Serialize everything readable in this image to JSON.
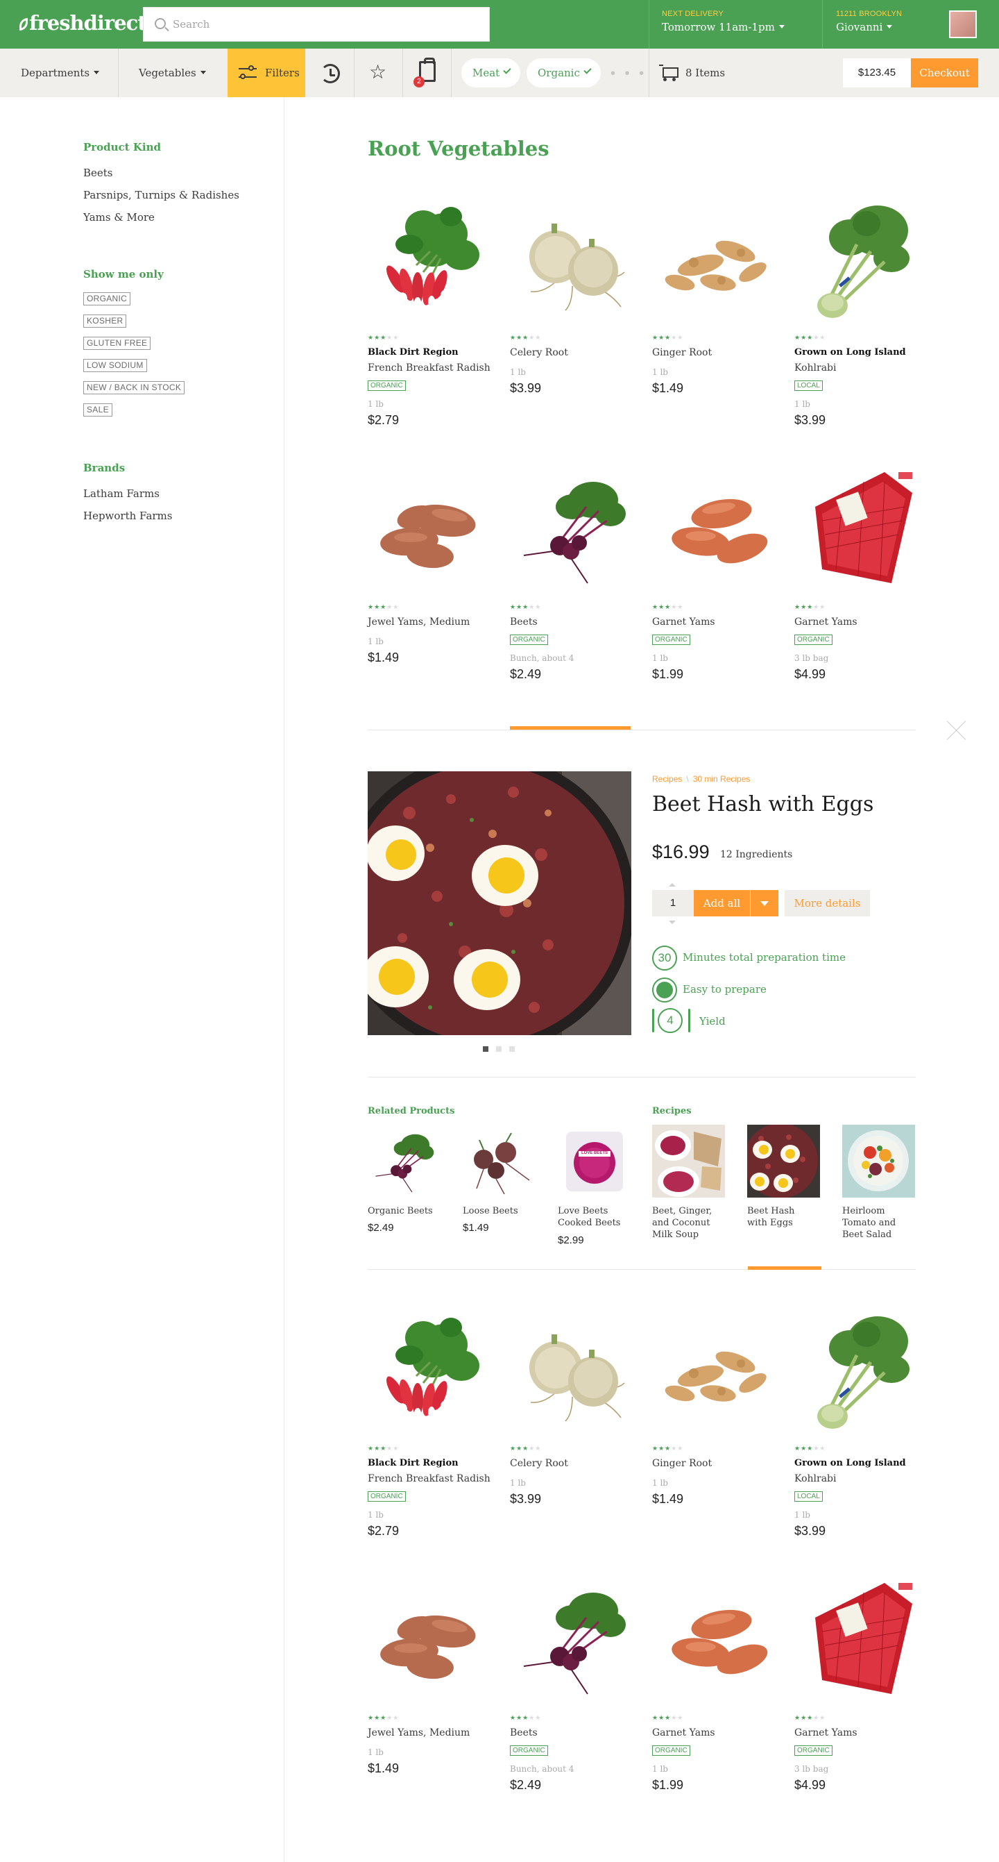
{
  "header": {
    "logo": "freshdirect",
    "search_placeholder": "Search",
    "delivery_label": "NEXT DELIVERY",
    "delivery_value": "Tomorrow 11am-1pm",
    "location_label": "11211 BROOKLYN",
    "user_name": "Giovanni"
  },
  "navbar": {
    "departments": "Departments",
    "vegetables": "Vegetables",
    "filters": "Filters",
    "bag_count": "2",
    "chips": [
      "Meat",
      "Organic"
    ],
    "dots": "• • •",
    "cart_items": "8 Items",
    "total": "$123.45",
    "checkout": "Checkout"
  },
  "sidebar": {
    "product_kind_title": "Product Kind",
    "product_kinds": [
      "Beets",
      "Parsnips, Turnips & Radishes",
      "Yams & More"
    ],
    "show_only_title": "Show me only",
    "show_only": [
      "ORGANIC",
      "KOSHER",
      "GLUTEN FREE",
      "LOW SODIUM",
      "NEW / BACK IN STOCK",
      "SALE"
    ],
    "brands_title": "Brands",
    "brands": [
      "Latham Farms",
      "Hepworth Farms"
    ]
  },
  "main": {
    "title": "Root Vegetables",
    "stars_text": "★★★★★",
    "products": [
      {
        "brand": "Black Dirt Region",
        "name": "French Breakfast Radish",
        "tag": "ORGANIC",
        "size": "1 lb",
        "price": "$2.79",
        "rating": 3,
        "image": "radish"
      },
      {
        "brand": "",
        "name": "Celery Root",
        "tag": "",
        "size": "1 lb",
        "price": "$3.99",
        "rating": 3,
        "image": "celery-root"
      },
      {
        "brand": "",
        "name": "Ginger Root",
        "tag": "",
        "size": "1 lb",
        "price": "$1.49",
        "rating": 3,
        "image": "ginger"
      },
      {
        "brand": "Grown on Long Island",
        "name": "Kohlrabi",
        "tag": "LOCAL",
        "size": "1 lb",
        "price": "$3.99",
        "rating": 3,
        "image": "kohlrabi"
      },
      {
        "brand": "",
        "name": "Jewel Yams, Medium",
        "tag": "",
        "size": "1 lb",
        "price": "$1.49",
        "rating": 3,
        "image": "yams"
      },
      {
        "brand": "",
        "name": "Beets",
        "tag": "ORGANIC",
        "size": "Bunch, about 4",
        "price": "$2.49",
        "rating": 3,
        "image": "beets"
      },
      {
        "brand": "",
        "name": "Garnet Yams",
        "tag": "ORGANIC",
        "size": "1 lb",
        "price": "$1.99",
        "rating": 3,
        "image": "garnet-yams"
      },
      {
        "brand": "",
        "name": "Garnet Yams",
        "tag": "ORGANIC",
        "size": "3 lb bag",
        "price": "$4.99",
        "rating": 3,
        "image": "yam-bag"
      }
    ]
  },
  "recipe": {
    "crumb_1": "Recipes",
    "crumb_sep": "\\",
    "crumb_2": "30 min Recipes",
    "title": "Beet Hash with Eggs",
    "price": "$16.99",
    "ingredients": "12 Ingredients",
    "quantity": "1",
    "add_all": "Add all",
    "more_details": "More details",
    "prep_time": "30",
    "prep_label": "Minutes total preparation time",
    "difficulty_label": "Easy to prepare",
    "yield": "4",
    "yield_label": "Yield",
    "slide_count": 3,
    "active_slide": 1
  },
  "related": {
    "products_title": "Related Products",
    "recipes_title": "Recipes",
    "products": [
      {
        "name": "Organic Beets",
        "price": "$2.49",
        "image": "beets"
      },
      {
        "name": "Loose Beets",
        "price": "$1.49",
        "image": "loose-beets"
      },
      {
        "name": "Love Beets Cooked Beets",
        "price": "$2.99",
        "image": "love-beets"
      }
    ],
    "love_beets_label": "LOVE BEETS",
    "recipes": [
      {
        "name": "Beet, Ginger, and Coconut Milk Soup",
        "image": "soup"
      },
      {
        "name": "Beet Hash with Eggs",
        "image": "hash"
      },
      {
        "name": "Heirloom Tomato and Beet Salad",
        "image": "salad"
      }
    ],
    "active_recipe": 1
  },
  "colors": {
    "brand_green": "#4aa154",
    "accent_orange": "#fe9a30",
    "filter_yellow": "#ffc338",
    "delivery_yellow": "#ffcc3f"
  }
}
